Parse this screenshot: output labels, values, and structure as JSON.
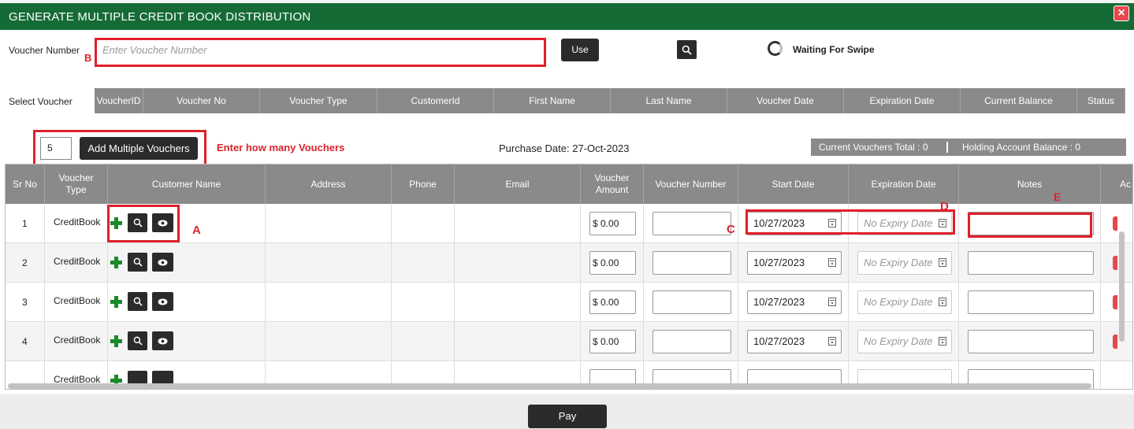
{
  "window": {
    "title": "GENERATE MULTIPLE CREDIT BOOK DISTRIBUTION",
    "close_glyph": "×"
  },
  "voucher_search": {
    "label": "Voucher Number",
    "placeholder": "Enter Voucher Number",
    "use_label": "Use",
    "search_icon": "search-icon",
    "swipe_status": "Waiting For Swipe"
  },
  "select_voucher": {
    "label": "Select Voucher",
    "columns": [
      "VoucherID",
      "Voucher No",
      "Voucher Type",
      "CustomerId",
      "First Name",
      "Last Name",
      "Voucher Date",
      "Expiration Date",
      "Current Balance",
      "Status"
    ]
  },
  "bulk_add": {
    "count_value": "5",
    "button_label": "Add Multiple Vouchers",
    "hint": "Enter how many Vouchers"
  },
  "purchase_date": "Purchase Date: 27-Oct-2023",
  "totals": {
    "current_vouchers": "Current Vouchers Total : 0",
    "holding_balance": "Holding Account Balance : 0"
  },
  "grid": {
    "columns": {
      "sr_no": "Sr No",
      "voucher_type": "Voucher Type",
      "customer_name": "Customer Name",
      "address": "Address",
      "phone": "Phone",
      "email": "Email",
      "voucher_amount": "Voucher Amount",
      "voucher_number": "Voucher Number",
      "start_date": "Start Date",
      "expiration_date": "Expiration Date",
      "notes": "Notes",
      "actions": "Ac"
    },
    "rows": [
      {
        "sr": "1",
        "type": "CreditBook",
        "amount": "$ 0.00",
        "start": "10/27/2023",
        "expiry_placeholder": "No Expiry Date"
      },
      {
        "sr": "2",
        "type": "CreditBook",
        "amount": "$ 0.00",
        "start": "10/27/2023",
        "expiry_placeholder": "No Expiry Date"
      },
      {
        "sr": "3",
        "type": "CreditBook",
        "amount": "$ 0.00",
        "start": "10/27/2023",
        "expiry_placeholder": "No Expiry Date"
      },
      {
        "sr": "4",
        "type": "CreditBook",
        "amount": "$ 0.00",
        "start": "10/27/2023",
        "expiry_placeholder": "No Expiry Date"
      },
      {
        "sr": "",
        "type": "CreditBook",
        "amount": "",
        "start": "",
        "expiry_placeholder": ""
      }
    ]
  },
  "annotations": {
    "a": "A",
    "b": "B",
    "c": "C",
    "d": "D",
    "e": "E"
  },
  "footer": {
    "pay_label": "Pay"
  },
  "colors": {
    "title_bar": "#156b36",
    "annotation_red": "#e0202a",
    "header_gray": "#8a8a8a",
    "plus_green": "#1a8a2a"
  }
}
